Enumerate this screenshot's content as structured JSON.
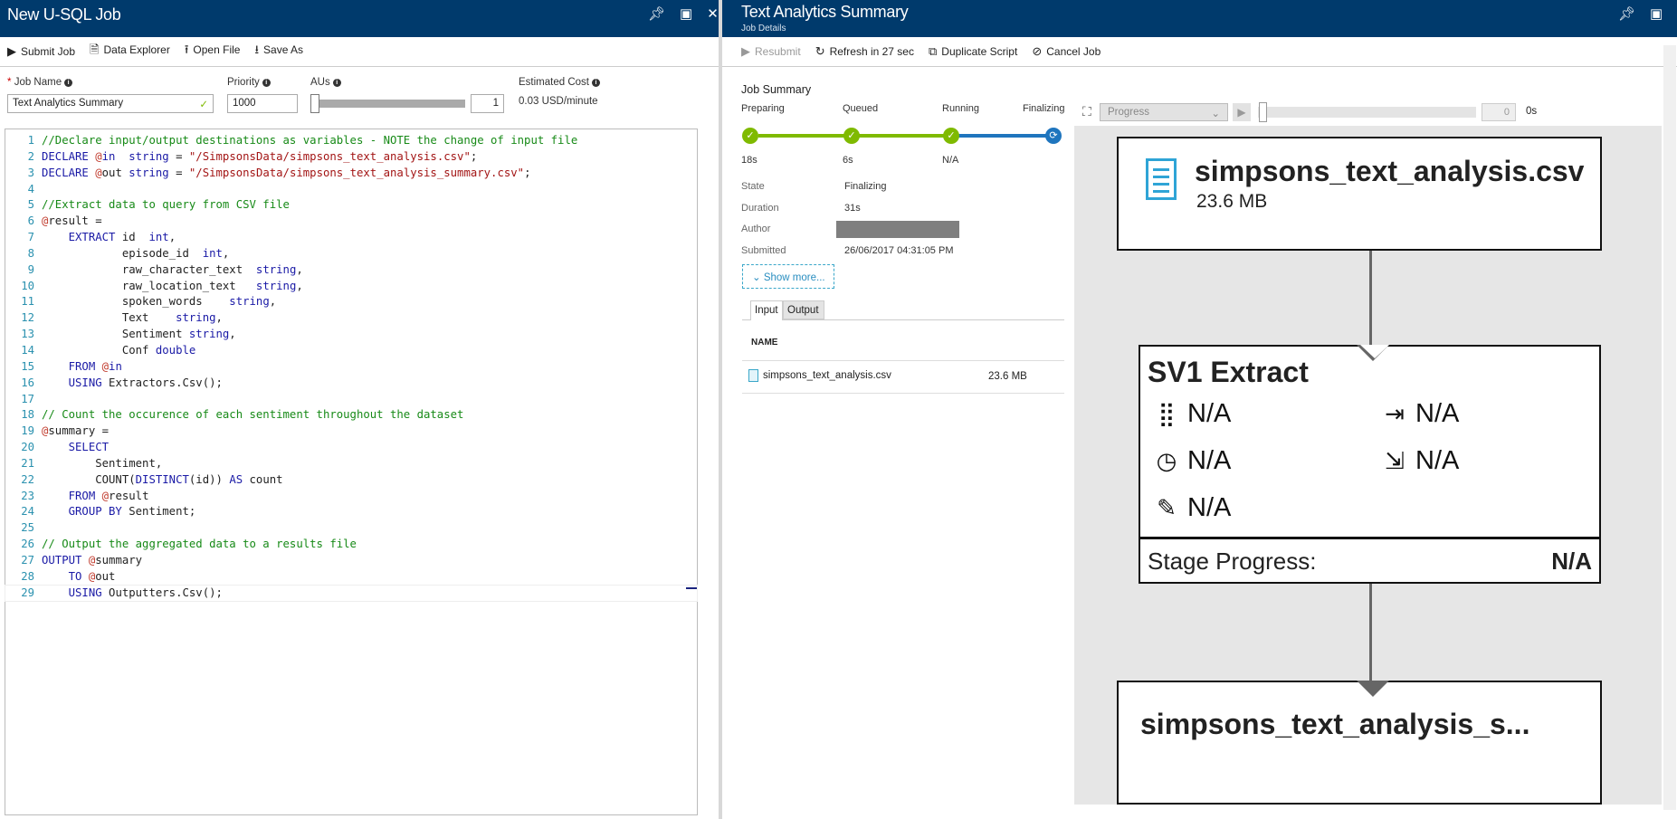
{
  "left": {
    "title": "New U-SQL Job",
    "toolbar": [
      {
        "icon": "play-icon",
        "glyph": "▶",
        "label": "Submit Job"
      },
      {
        "icon": "document-icon",
        "glyph": "🗎",
        "label": "Data Explorer"
      },
      {
        "icon": "upload-icon",
        "glyph": "⭱",
        "label": "Open File"
      },
      {
        "icon": "download-icon",
        "glyph": "⭳",
        "label": "Save As"
      }
    ],
    "form": {
      "job_name_label": "Job Name",
      "job_name": "Text Analytics Summary",
      "priority_label": "Priority",
      "priority": "1000",
      "aus_label": "AUs",
      "aus": "1",
      "aus_fraction": 0,
      "cost_label": "Estimated Cost",
      "cost": "0.03 USD/minute",
      "required": "*"
    },
    "code": [
      [
        [
          "c",
          "//Declare input/output destinations as variables - NOTE the change of input file"
        ]
      ],
      [
        [
          "k",
          "DECLARE"
        ],
        [
          "t",
          " "
        ],
        [
          "v",
          "@"
        ],
        [
          "k",
          "in"
        ],
        [
          "t",
          "  "
        ],
        [
          "k",
          "string"
        ],
        [
          "t",
          " = "
        ],
        [
          "s",
          "\"/SimpsonsData/simpsons_text_analysis.csv\""
        ],
        [
          "t",
          ";"
        ]
      ],
      [
        [
          "k",
          "DECLARE"
        ],
        [
          "t",
          " "
        ],
        [
          "v",
          "@"
        ],
        [
          "t",
          "out "
        ],
        [
          "k",
          "string"
        ],
        [
          "t",
          " = "
        ],
        [
          "s",
          "\"/SimpsonsData/simpsons_text_analysis_summary.csv\""
        ],
        [
          "t",
          ";"
        ]
      ],
      [],
      [
        [
          "c",
          "//Extract data to query from CSV file"
        ]
      ],
      [
        [
          "v",
          "@"
        ],
        [
          "t",
          "result ="
        ]
      ],
      [
        [
          "k",
          "    EXTRACT"
        ],
        [
          "t",
          " id  "
        ],
        [
          "k",
          "int"
        ],
        [
          "t",
          ","
        ]
      ],
      [
        [
          "t",
          "            episode_id  "
        ],
        [
          "k",
          "int"
        ],
        [
          "t",
          ","
        ]
      ],
      [
        [
          "t",
          "            raw_character_text  "
        ],
        [
          "k",
          "string"
        ],
        [
          "t",
          ","
        ]
      ],
      [
        [
          "t",
          "            raw_location_text   "
        ],
        [
          "k",
          "string"
        ],
        [
          "t",
          ","
        ]
      ],
      [
        [
          "t",
          "            spoken_words    "
        ],
        [
          "k",
          "string"
        ],
        [
          "t",
          ","
        ]
      ],
      [
        [
          "t",
          "            Text    "
        ],
        [
          "k",
          "string"
        ],
        [
          "t",
          ","
        ]
      ],
      [
        [
          "t",
          "            Sentiment "
        ],
        [
          "k",
          "string"
        ],
        [
          "t",
          ","
        ]
      ],
      [
        [
          "t",
          "            Conf "
        ],
        [
          "k",
          "double"
        ]
      ],
      [
        [
          "k",
          "    FROM"
        ],
        [
          "t",
          " "
        ],
        [
          "v",
          "@"
        ],
        [
          "k",
          "in"
        ]
      ],
      [
        [
          "k",
          "    USING"
        ],
        [
          "t",
          " Extractors.Csv();"
        ]
      ],
      [],
      [
        [
          "c",
          "// Count the occurence of each sentiment throughout the dataset"
        ]
      ],
      [
        [
          "v",
          "@"
        ],
        [
          "t",
          "summary ="
        ]
      ],
      [
        [
          "k",
          "    SELECT"
        ]
      ],
      [
        [
          "t",
          "        Sentiment,"
        ]
      ],
      [
        [
          "t",
          "        COUNT("
        ],
        [
          "k",
          "DISTINCT"
        ],
        [
          "t",
          "(id)) "
        ],
        [
          "k",
          "AS"
        ],
        [
          "t",
          " count"
        ]
      ],
      [
        [
          "k",
          "    FROM"
        ],
        [
          "t",
          " "
        ],
        [
          "v",
          "@"
        ],
        [
          "t",
          "result"
        ]
      ],
      [
        [
          "k",
          "    GROUP BY"
        ],
        [
          "t",
          " Sentiment;"
        ]
      ],
      [],
      [
        [
          "c",
          "// Output the aggregated data to a results file"
        ]
      ],
      [
        [
          "k",
          "OUTPUT"
        ],
        [
          "t",
          " "
        ],
        [
          "v",
          "@"
        ],
        [
          "t",
          "summary"
        ]
      ],
      [
        [
          "k",
          "    TO"
        ],
        [
          "t",
          " "
        ],
        [
          "v",
          "@"
        ],
        [
          "t",
          "out"
        ]
      ],
      [
        [
          "k",
          "    USING"
        ],
        [
          "t",
          " Outputters.Csv();"
        ]
      ]
    ]
  },
  "right": {
    "title": "Text Analytics Summary",
    "subtitle": "Job Details",
    "toolbar": [
      {
        "icon": "play-icon",
        "glyph": "▶",
        "label": "Resubmit",
        "disabled": true
      },
      {
        "icon": "refresh-icon",
        "glyph": "↻",
        "label": "Refresh in 27 sec"
      },
      {
        "icon": "duplicate-icon",
        "glyph": "⧉",
        "label": "Duplicate Script"
      },
      {
        "icon": "cancel-icon",
        "glyph": "⊘",
        "label": "Cancel Job"
      }
    ],
    "summary_title": "Job Summary",
    "stages": [
      {
        "label": "Preparing",
        "time": "18s",
        "status": "done"
      },
      {
        "label": "Queued",
        "time": "6s",
        "status": "done"
      },
      {
        "label": "Running",
        "time": "N/A",
        "status": "done"
      },
      {
        "label": "Finalizing",
        "time": "",
        "status": "in-progress"
      }
    ],
    "details": [
      {
        "k": "State",
        "v": "Finalizing"
      },
      {
        "k": "Duration",
        "v": "31s"
      },
      {
        "k": "Author",
        "v": ""
      },
      {
        "k": "Submitted",
        "v": "26/06/2017 04:31:05 PM"
      }
    ],
    "show_more": "Show more...",
    "tabs": [
      "Input",
      "Output"
    ],
    "table_header": "NAME",
    "files": [
      {
        "name": "simpsons_text_analysis.csv",
        "size": "23.6 MB"
      }
    ],
    "graph_controls": {
      "select": "Progress",
      "frame": "0",
      "time": "0s"
    },
    "graph": {
      "input": {
        "name": "simpsons_text_analysis.csv",
        "size": "23.6 MB"
      },
      "stage": {
        "name": "SV1 Extract",
        "vertices": "N/A",
        "input": "N/A",
        "time": "N/A",
        "output": "N/A",
        "rows": "N/A",
        "progress_label": "Stage Progress:",
        "progress": "N/A"
      },
      "output": {
        "name": "simpsons_text_analysis_s..."
      }
    },
    "colors": {
      "done": "#7fba00",
      "running": "#1f75be",
      "header": "#003a6c"
    }
  }
}
